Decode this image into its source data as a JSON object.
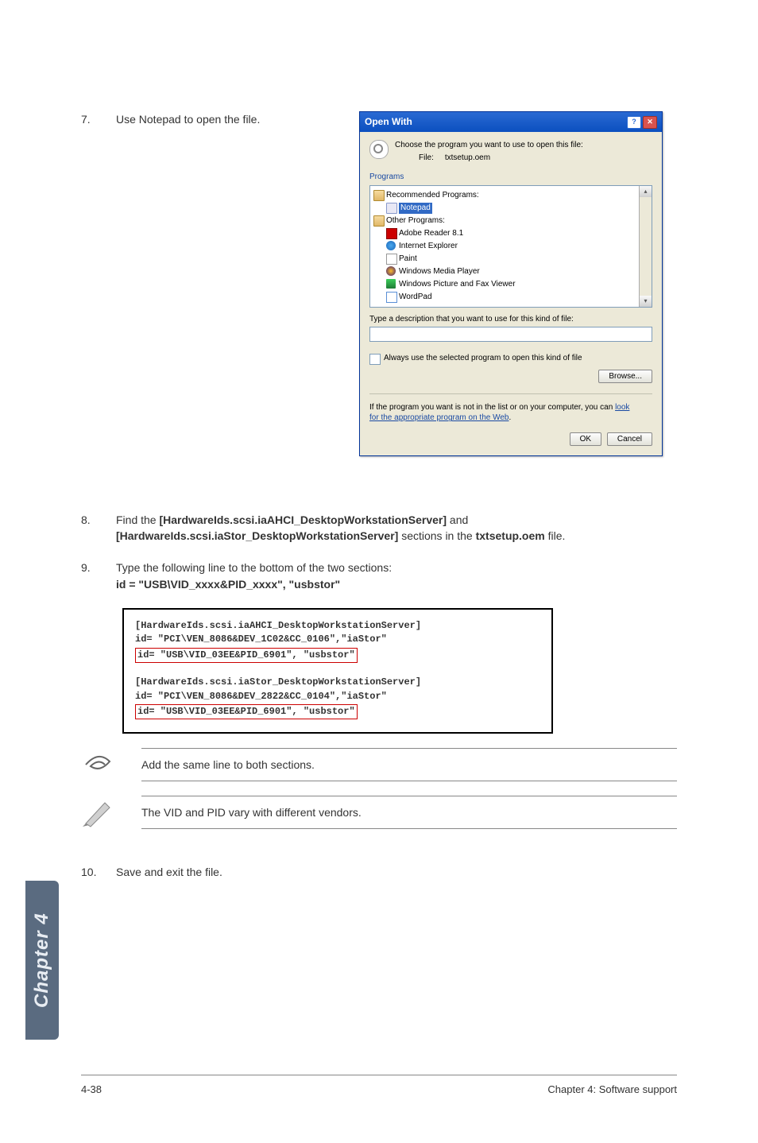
{
  "steps": {
    "s7": {
      "num": "7.",
      "text": "Use Notepad to open the file."
    },
    "s8": {
      "num": "8.",
      "pre": "Find the ",
      "b1": "[HardwareIds.scsi.iaAHCI_DesktopWorkstationServer]",
      "mid": " and ",
      "b2": "[HardwareIds.scsi.iaStor_DesktopWorkstationServer]",
      "post1": " sections in the ",
      "b3": "txtsetup.oem",
      "post2": " file."
    },
    "s9": {
      "num": "9.",
      "line1": "Type the following line to the bottom of the two sections:",
      "line2": "id = \"USB\\VID_xxxx&PID_xxxx\", \"usbstor\""
    },
    "s10": {
      "num": "10.",
      "text": "Save and exit the file."
    }
  },
  "dialog": {
    "title": "Open With",
    "choose": "Choose the program you want to use to open this file:",
    "file_label": "File:",
    "file_name": "txtsetup.oem",
    "programs_label": "Programs",
    "rec_label": "Recommended Programs:",
    "notepad": "Notepad",
    "other_label": "Other Programs:",
    "items": {
      "adobe": "Adobe Reader 8.1",
      "ie": "Internet Explorer",
      "paint": "Paint",
      "wmp": "Windows Media Player",
      "wpfv": "Windows Picture and Fax Viewer",
      "wordpad": "WordPad"
    },
    "desc_label": "Type a description that you want to use for this kind of file:",
    "always": "Always use the selected program to open this kind of file",
    "browse": "Browse...",
    "note_pre": "If the program you want is not in the list or on your computer, you can ",
    "note_link1": "look",
    "note_link2": "for the appropriate program on the Web",
    "ok": "OK",
    "cancel": "Cancel",
    "help_glyph": "?",
    "close_glyph": "✕",
    "up_glyph": "▴",
    "down_glyph": "▾"
  },
  "code": {
    "a1": "[HardwareIds.scsi.iaAHCI_DesktopWorkstationServer]",
    "a2": "id= \"PCI\\VEN_8086&DEV_1C02&CC_0106\",\"iaStor\"",
    "a3": "id= \"USB\\VID_03EE&PID_6901\", \"usbstor\"",
    "b1": "[HardwareIds.scsi.iaStor_DesktopWorkstationServer]",
    "b2": "id= \"PCI\\VEN_8086&DEV_2822&CC_0104\",\"iaStor\"",
    "b3": "id= \"USB\\VID_03EE&PID_6901\", \"usbstor\""
  },
  "notes": {
    "n1": "Add the same line to both sections.",
    "n2": "The VID and PID vary with different vendors."
  },
  "sidebar": "Chapter 4",
  "footer": {
    "left": "4-38",
    "right": "Chapter 4: Software support"
  }
}
